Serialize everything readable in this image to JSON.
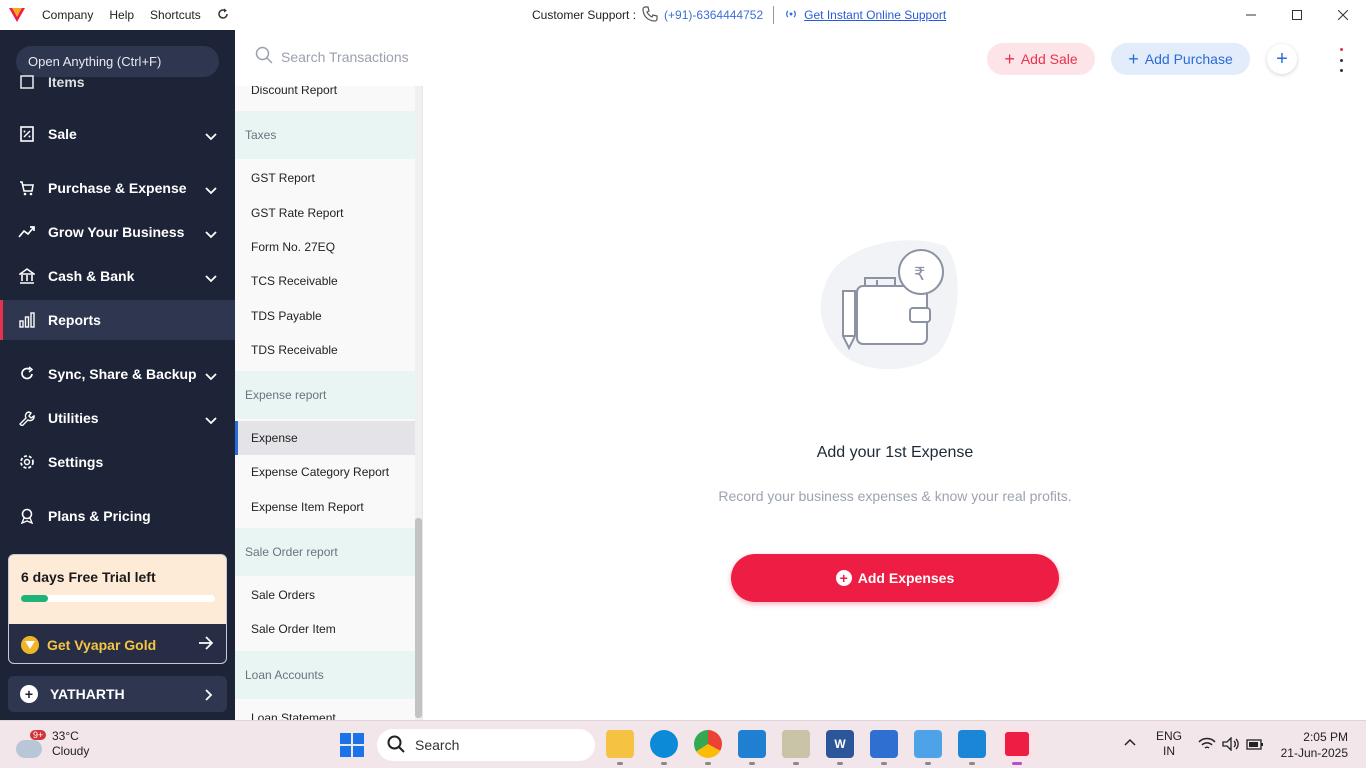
{
  "titlebar": {
    "menu": [
      "Company",
      "Help",
      "Shortcuts"
    ],
    "support_label": "Customer Support :",
    "support_phone": "(+91)-6364444752",
    "support_link": "Get Instant Online Support"
  },
  "sidebar": {
    "open_anything": "Open Anything (Ctrl+F)",
    "partial_item": "Items",
    "items": [
      {
        "label": "Sale",
        "icon": "sale-icon",
        "expandable": true
      },
      {
        "label": "Purchase & Expense",
        "icon": "cart-icon",
        "expandable": true
      },
      {
        "label": "Grow Your Business",
        "icon": "trend-icon",
        "expandable": true
      },
      {
        "label": "Cash & Bank",
        "icon": "bank-icon",
        "expandable": true
      },
      {
        "label": "Reports",
        "icon": "chart-icon",
        "expandable": false,
        "active": true
      },
      {
        "label": "Sync, Share & Backup",
        "icon": "sync-icon",
        "expandable": true
      },
      {
        "label": "Utilities",
        "icon": "wrench-icon",
        "expandable": true
      },
      {
        "label": "Settings",
        "icon": "gear-icon",
        "expandable": false
      },
      {
        "label": "Plans & Pricing",
        "icon": "badge-icon",
        "expandable": false
      }
    ],
    "trial": {
      "title": "6 days Free Trial left",
      "progress_fraction": 0.14,
      "cta": "Get Vyapar Gold"
    },
    "company_name": "YATHARTH"
  },
  "topbar": {
    "search_placeholder": "Search Transactions",
    "add_sale": "Add Sale",
    "add_purchase": "Add Purchase"
  },
  "reports": {
    "list": [
      {
        "type": "item",
        "label": "Discount Report"
      },
      {
        "type": "header",
        "label": "Taxes"
      },
      {
        "type": "item",
        "label": "GST Report"
      },
      {
        "type": "item",
        "label": "GST Rate Report"
      },
      {
        "type": "item",
        "label": "Form No. 27EQ"
      },
      {
        "type": "item",
        "label": "TCS Receivable"
      },
      {
        "type": "item",
        "label": "TDS Payable"
      },
      {
        "type": "item",
        "label": "TDS Receivable"
      },
      {
        "type": "header",
        "label": "Expense report"
      },
      {
        "type": "item",
        "label": "Expense",
        "selected": true
      },
      {
        "type": "item",
        "label": "Expense Category Report"
      },
      {
        "type": "item",
        "label": "Expense Item Report"
      },
      {
        "type": "header",
        "label": "Sale Order report"
      },
      {
        "type": "item",
        "label": "Sale Orders"
      },
      {
        "type": "item",
        "label": "Sale Order Item"
      },
      {
        "type": "header",
        "label": "Loan Accounts"
      },
      {
        "type": "item",
        "label": "Loan Statement"
      }
    ]
  },
  "main": {
    "empty_title": "Add your 1st Expense",
    "empty_subtitle": "Record your business expenses & know your real profits.",
    "add_button": "Add Expenses"
  },
  "taskbar": {
    "weather_temp": "33°C",
    "weather_desc": "Cloudy",
    "weather_badge": "9+",
    "search": "Search",
    "lang1": "ENG",
    "lang2": "IN",
    "time": "2:05 PM",
    "date": "21-Jun-2025"
  },
  "colors": {
    "brand_red": "#ed1d44",
    "sidebar_bg": "#1e2437",
    "accent_blue": "#2a6bd8"
  }
}
